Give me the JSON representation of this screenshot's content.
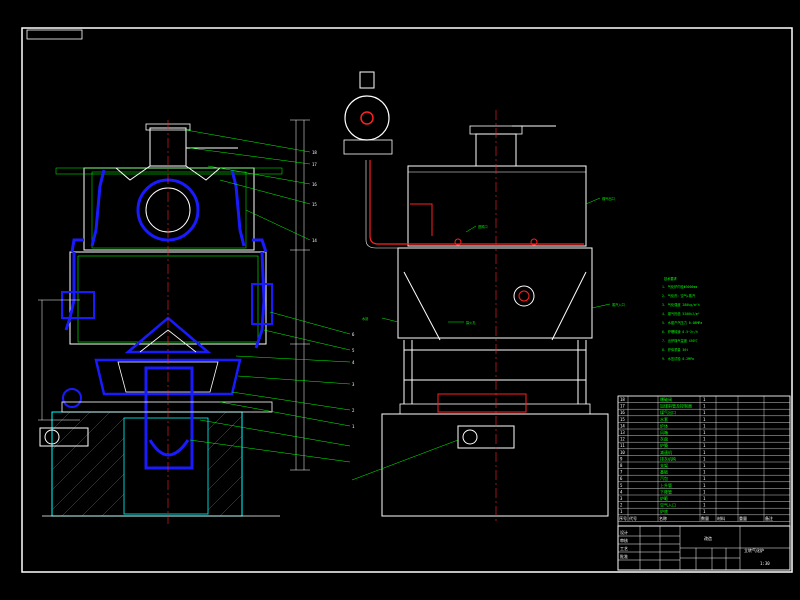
{
  "drawing": {
    "title_block": {
      "drawing_name": "立转气化炉",
      "sheet_no": "1:30",
      "signature_rows": [
        "设计",
        "审核",
        "工艺",
        "批准"
      ],
      "header_label": "改造"
    },
    "parts_table": {
      "rows": [
        {
          "no": "18",
          "name": "爆破阀",
          "qty": "1"
        },
        {
          "no": "17",
          "name": "加煤斜管及控制器",
          "qty": "1"
        },
        {
          "no": "16",
          "name": "煤气出口",
          "qty": "1"
        },
        {
          "no": "15",
          "name": "水套",
          "qty": "1"
        },
        {
          "no": "14",
          "name": "炉体",
          "qty": "1"
        },
        {
          "no": "13",
          "name": "风箱",
          "qty": "1"
        },
        {
          "no": "12",
          "name": "灰盘",
          "qty": "1"
        },
        {
          "no": "11",
          "name": "炉築",
          "qty": "1"
        },
        {
          "no": "10",
          "name": "减速机",
          "qty": "1"
        },
        {
          "no": "9",
          "name": "排灰机构",
          "qty": "1"
        },
        {
          "no": "8",
          "name": "支架",
          "qty": "1"
        },
        {
          "no": "7",
          "name": "基础",
          "qty": "1"
        },
        {
          "no": "6",
          "name": "汽包",
          "qty": "1"
        },
        {
          "no": "5",
          "name": "上升管",
          "qty": "1"
        },
        {
          "no": "4",
          "name": "下降管",
          "qty": "1"
        },
        {
          "no": "3",
          "name": "炉範",
          "qty": "1"
        },
        {
          "no": "2",
          "name": "空气入口",
          "qty": "1"
        },
        {
          "no": "1",
          "name": "炉底",
          "qty": "1"
        }
      ],
      "header": [
        "序号",
        "代号",
        "名称",
        "数量",
        "材料",
        "重量",
        "备注"
      ]
    },
    "tech_notes": {
      "title": "技术要求",
      "lines": [
        "1. 气化炉内径Φ3000mm",
        "2. 气化剂：空气+蒸汽",
        "3. 气化强度 280kg/m²h",
        "4. 煤气热值 5200kJ/m³",
        "5. 水套产汽压力 0.08MPa",
        "6. 炉栅转速 0.5~2r/h",
        "7. 出炉煤气温度 450℃",
        "8. 炉体重量 36t",
        "9. 水压试验 0.2MPa"
      ]
    },
    "callouts": {
      "right_view_labels": [
        "煤气出口",
        "进风口",
        "探火孔",
        "蒸汽入口",
        "水封"
      ],
      "left_numbers": [
        "18",
        "17",
        "16",
        "15",
        "14",
        "13",
        "12",
        "11",
        "10",
        "9",
        "8",
        "7",
        "6",
        "5",
        "4",
        "3",
        "2",
        "1"
      ]
    },
    "corner_label": ""
  }
}
